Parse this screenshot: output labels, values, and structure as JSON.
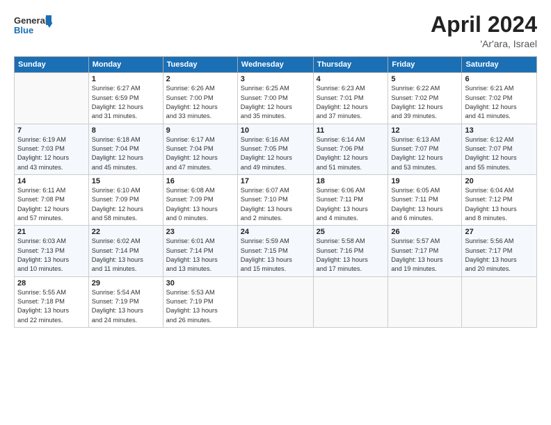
{
  "logo": {
    "line1": "General",
    "line2": "Blue"
  },
  "title": "April 2024",
  "location": "'Ar'ara, Israel",
  "weekdays": [
    "Sunday",
    "Monday",
    "Tuesday",
    "Wednesday",
    "Thursday",
    "Friday",
    "Saturday"
  ],
  "weeks": [
    [
      {
        "day": "",
        "info": ""
      },
      {
        "day": "1",
        "info": "Sunrise: 6:27 AM\nSunset: 6:59 PM\nDaylight: 12 hours\nand 31 minutes."
      },
      {
        "day": "2",
        "info": "Sunrise: 6:26 AM\nSunset: 7:00 PM\nDaylight: 12 hours\nand 33 minutes."
      },
      {
        "day": "3",
        "info": "Sunrise: 6:25 AM\nSunset: 7:00 PM\nDaylight: 12 hours\nand 35 minutes."
      },
      {
        "day": "4",
        "info": "Sunrise: 6:23 AM\nSunset: 7:01 PM\nDaylight: 12 hours\nand 37 minutes."
      },
      {
        "day": "5",
        "info": "Sunrise: 6:22 AM\nSunset: 7:02 PM\nDaylight: 12 hours\nand 39 minutes."
      },
      {
        "day": "6",
        "info": "Sunrise: 6:21 AM\nSunset: 7:02 PM\nDaylight: 12 hours\nand 41 minutes."
      }
    ],
    [
      {
        "day": "7",
        "info": "Sunrise: 6:19 AM\nSunset: 7:03 PM\nDaylight: 12 hours\nand 43 minutes."
      },
      {
        "day": "8",
        "info": "Sunrise: 6:18 AM\nSunset: 7:04 PM\nDaylight: 12 hours\nand 45 minutes."
      },
      {
        "day": "9",
        "info": "Sunrise: 6:17 AM\nSunset: 7:04 PM\nDaylight: 12 hours\nand 47 minutes."
      },
      {
        "day": "10",
        "info": "Sunrise: 6:16 AM\nSunset: 7:05 PM\nDaylight: 12 hours\nand 49 minutes."
      },
      {
        "day": "11",
        "info": "Sunrise: 6:14 AM\nSunset: 7:06 PM\nDaylight: 12 hours\nand 51 minutes."
      },
      {
        "day": "12",
        "info": "Sunrise: 6:13 AM\nSunset: 7:07 PM\nDaylight: 12 hours\nand 53 minutes."
      },
      {
        "day": "13",
        "info": "Sunrise: 6:12 AM\nSunset: 7:07 PM\nDaylight: 12 hours\nand 55 minutes."
      }
    ],
    [
      {
        "day": "14",
        "info": "Sunrise: 6:11 AM\nSunset: 7:08 PM\nDaylight: 12 hours\nand 57 minutes."
      },
      {
        "day": "15",
        "info": "Sunrise: 6:10 AM\nSunset: 7:09 PM\nDaylight: 12 hours\nand 58 minutes."
      },
      {
        "day": "16",
        "info": "Sunrise: 6:08 AM\nSunset: 7:09 PM\nDaylight: 13 hours\nand 0 minutes."
      },
      {
        "day": "17",
        "info": "Sunrise: 6:07 AM\nSunset: 7:10 PM\nDaylight: 13 hours\nand 2 minutes."
      },
      {
        "day": "18",
        "info": "Sunrise: 6:06 AM\nSunset: 7:11 PM\nDaylight: 13 hours\nand 4 minutes."
      },
      {
        "day": "19",
        "info": "Sunrise: 6:05 AM\nSunset: 7:11 PM\nDaylight: 13 hours\nand 6 minutes."
      },
      {
        "day": "20",
        "info": "Sunrise: 6:04 AM\nSunset: 7:12 PM\nDaylight: 13 hours\nand 8 minutes."
      }
    ],
    [
      {
        "day": "21",
        "info": "Sunrise: 6:03 AM\nSunset: 7:13 PM\nDaylight: 13 hours\nand 10 minutes."
      },
      {
        "day": "22",
        "info": "Sunrise: 6:02 AM\nSunset: 7:14 PM\nDaylight: 13 hours\nand 11 minutes."
      },
      {
        "day": "23",
        "info": "Sunrise: 6:01 AM\nSunset: 7:14 PM\nDaylight: 13 hours\nand 13 minutes."
      },
      {
        "day": "24",
        "info": "Sunrise: 5:59 AM\nSunset: 7:15 PM\nDaylight: 13 hours\nand 15 minutes."
      },
      {
        "day": "25",
        "info": "Sunrise: 5:58 AM\nSunset: 7:16 PM\nDaylight: 13 hours\nand 17 minutes."
      },
      {
        "day": "26",
        "info": "Sunrise: 5:57 AM\nSunset: 7:17 PM\nDaylight: 13 hours\nand 19 minutes."
      },
      {
        "day": "27",
        "info": "Sunrise: 5:56 AM\nSunset: 7:17 PM\nDaylight: 13 hours\nand 20 minutes."
      }
    ],
    [
      {
        "day": "28",
        "info": "Sunrise: 5:55 AM\nSunset: 7:18 PM\nDaylight: 13 hours\nand 22 minutes."
      },
      {
        "day": "29",
        "info": "Sunrise: 5:54 AM\nSunset: 7:19 PM\nDaylight: 13 hours\nand 24 minutes."
      },
      {
        "day": "30",
        "info": "Sunrise: 5:53 AM\nSunset: 7:19 PM\nDaylight: 13 hours\nand 26 minutes."
      },
      {
        "day": "",
        "info": ""
      },
      {
        "day": "",
        "info": ""
      },
      {
        "day": "",
        "info": ""
      },
      {
        "day": "",
        "info": ""
      }
    ]
  ]
}
